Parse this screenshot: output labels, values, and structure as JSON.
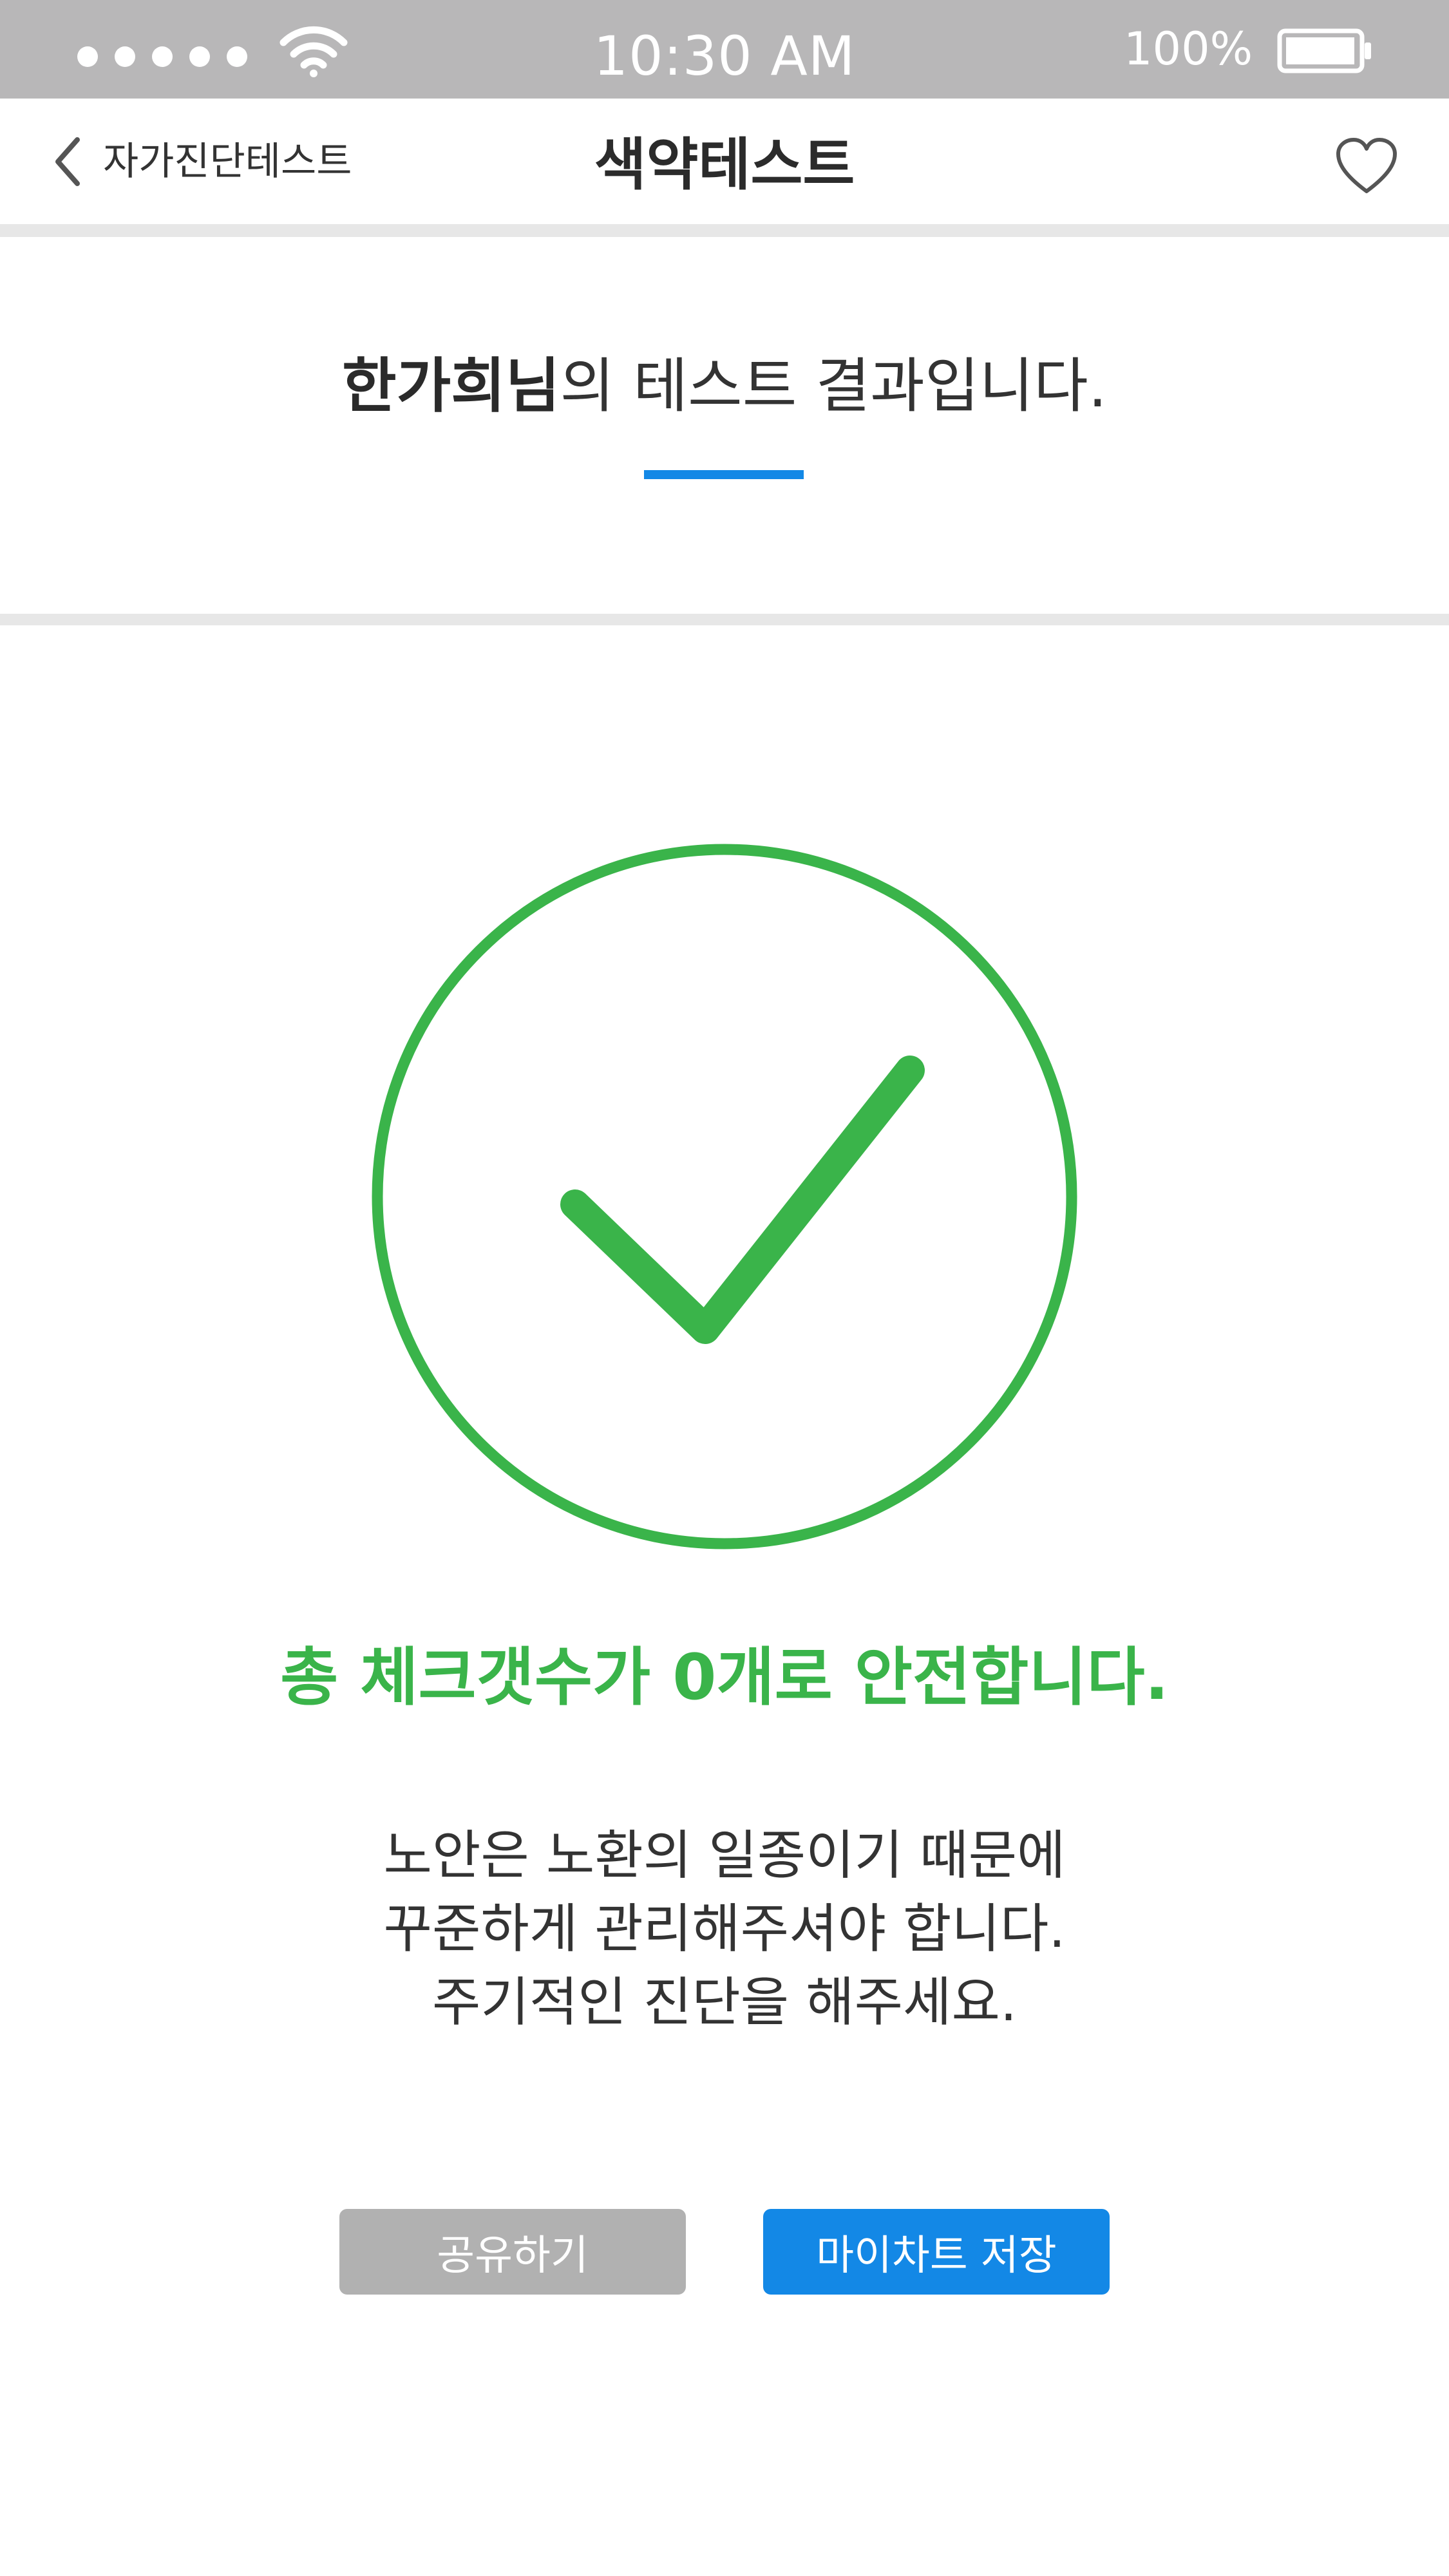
{
  "status_bar": {
    "time": "10:30 AM",
    "battery_percent": "100%",
    "battery_level": 0.95,
    "signal_icon": "signal-dots-icon",
    "wifi_icon": "wifi-icon",
    "battery_icon": "battery-icon"
  },
  "nav": {
    "back_label": "자가진단테스트",
    "title": "색약테스트",
    "favorite_icon": "heart-icon"
  },
  "result": {
    "user_name": "한가희님",
    "heading_rest": "의 테스트 결과입니다.",
    "status_icon": "check-circle-icon",
    "message": "총 체크갯수가 0개로 안전합니다.",
    "advice_lines": [
      "노안은 노환의 일종이기 때문에",
      "꾸준하게 관리해주셔야 합니다.",
      "주기적인 진단을 해주세요."
    ]
  },
  "actions": {
    "share_label": "공유하기",
    "save_label": "마이차트 저장"
  },
  "colors": {
    "status_bar": "#b8b7b8",
    "accent_blue": "#1388e6",
    "success_green": "#3ab44a",
    "share_button": "#b1b1b1"
  }
}
